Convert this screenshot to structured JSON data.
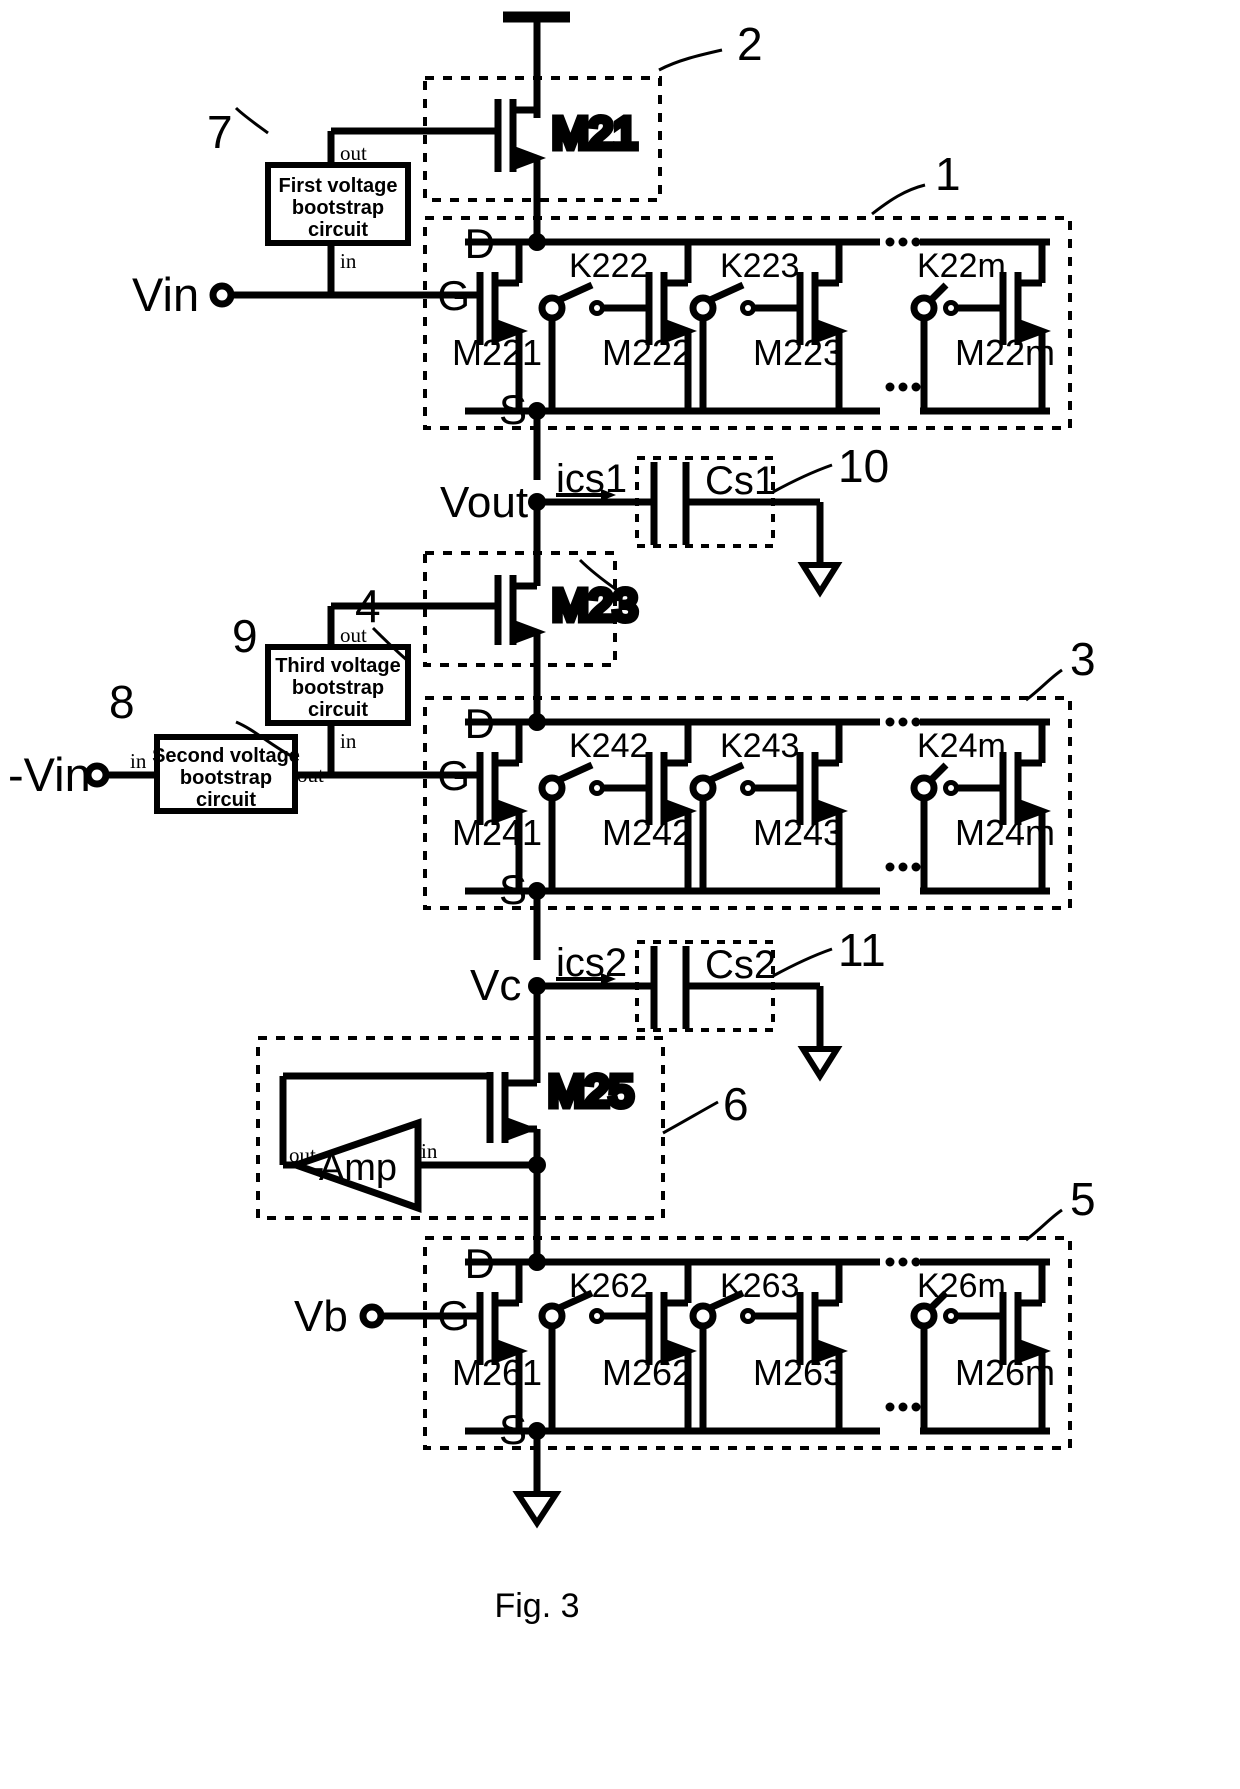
{
  "figure": {
    "caption": "Fig. 3"
  },
  "terminals": [
    {
      "name": "vin",
      "label": "Vin"
    },
    {
      "name": "neg-vin",
      "label": "-Vin"
    },
    {
      "name": "vout",
      "label": "Vout"
    },
    {
      "name": "vc",
      "label": "Vc"
    },
    {
      "name": "vb",
      "label": "Vb"
    }
  ],
  "reference_numerals": [
    {
      "name": "ref-1",
      "label": "1"
    },
    {
      "name": "ref-2",
      "label": "2"
    },
    {
      "name": "ref-3",
      "label": "3"
    },
    {
      "name": "ref-4",
      "label": "4"
    },
    {
      "name": "ref-5",
      "label": "5"
    },
    {
      "name": "ref-6",
      "label": "6"
    },
    {
      "name": "ref-7",
      "label": "7"
    },
    {
      "name": "ref-8",
      "label": "8"
    },
    {
      "name": "ref-9",
      "label": "9"
    },
    {
      "name": "ref-10",
      "label": "10"
    },
    {
      "name": "ref-11",
      "label": "11"
    }
  ],
  "blocks": {
    "first_bootstrap": {
      "title": "First voltage bootstrap circuit",
      "line1": "First voltage",
      "line2": "bootstrap",
      "line3": "circuit",
      "port_out": "out",
      "port_in": "in"
    },
    "second_bootstrap": {
      "title": "Second voltage bootstrap circuit",
      "line1": "Second voltage",
      "line2": "bootstrap",
      "line3": "circuit",
      "port_out": "out",
      "port_in": "in"
    },
    "third_bootstrap": {
      "title": "Third voltage bootstrap circuit",
      "line1": "Third voltage",
      "line2": "bootstrap",
      "line3": "circuit",
      "port_out": "out",
      "port_in": "in"
    },
    "amplifier": {
      "label": "Amp",
      "port_out": "out",
      "port_in": "in",
      "minus": "-"
    }
  },
  "single_transistors": [
    {
      "name": "m21",
      "label": "M21"
    },
    {
      "name": "m23",
      "label": "M23"
    },
    {
      "name": "m25",
      "label": "M25"
    }
  ],
  "node_labels": [
    {
      "name": "drain-label-1",
      "label": "D"
    },
    {
      "name": "gate-label-1",
      "label": "G"
    },
    {
      "name": "source-label-1",
      "label": "S"
    },
    {
      "name": "drain-label-3",
      "label": "D"
    },
    {
      "name": "gate-label-3",
      "label": "G"
    },
    {
      "name": "source-label-3",
      "label": "S"
    },
    {
      "name": "drain-label-5",
      "label": "D"
    },
    {
      "name": "gate-label-5",
      "label": "G"
    },
    {
      "name": "source-label-5",
      "label": "S"
    }
  ],
  "arrays": [
    {
      "name": "array-1",
      "ref": "1",
      "d": "D",
      "g": "G",
      "s": "S",
      "ellipsis": ". . .",
      "transistors": [
        "M221",
        "M222",
        "M223",
        "M22m"
      ],
      "switches": [
        "K222",
        "K223",
        "K22m"
      ]
    },
    {
      "name": "array-3",
      "ref": "3",
      "d": "D",
      "g": "G",
      "s": "S",
      "ellipsis": ". . .",
      "transistors": [
        "M241",
        "M242",
        "M243",
        "M24m"
      ],
      "switches": [
        "K242",
        "K243",
        "K24m"
      ]
    },
    {
      "name": "array-5",
      "ref": "5",
      "d": "D",
      "g": "G",
      "s": "S",
      "ellipsis": ". . .",
      "transistors": [
        "M261",
        "M262",
        "M263",
        "M26m"
      ],
      "switches": [
        "K262",
        "K263",
        "K26m"
      ]
    }
  ],
  "capacitors": [
    {
      "name": "cs1",
      "label": "Cs1",
      "current": "ics1",
      "ref": "10"
    },
    {
      "name": "cs2",
      "label": "Cs2",
      "current": "ics2",
      "ref": "11"
    }
  ],
  "colors": {
    "ink": "#000000",
    "paper": "#ffffff"
  }
}
